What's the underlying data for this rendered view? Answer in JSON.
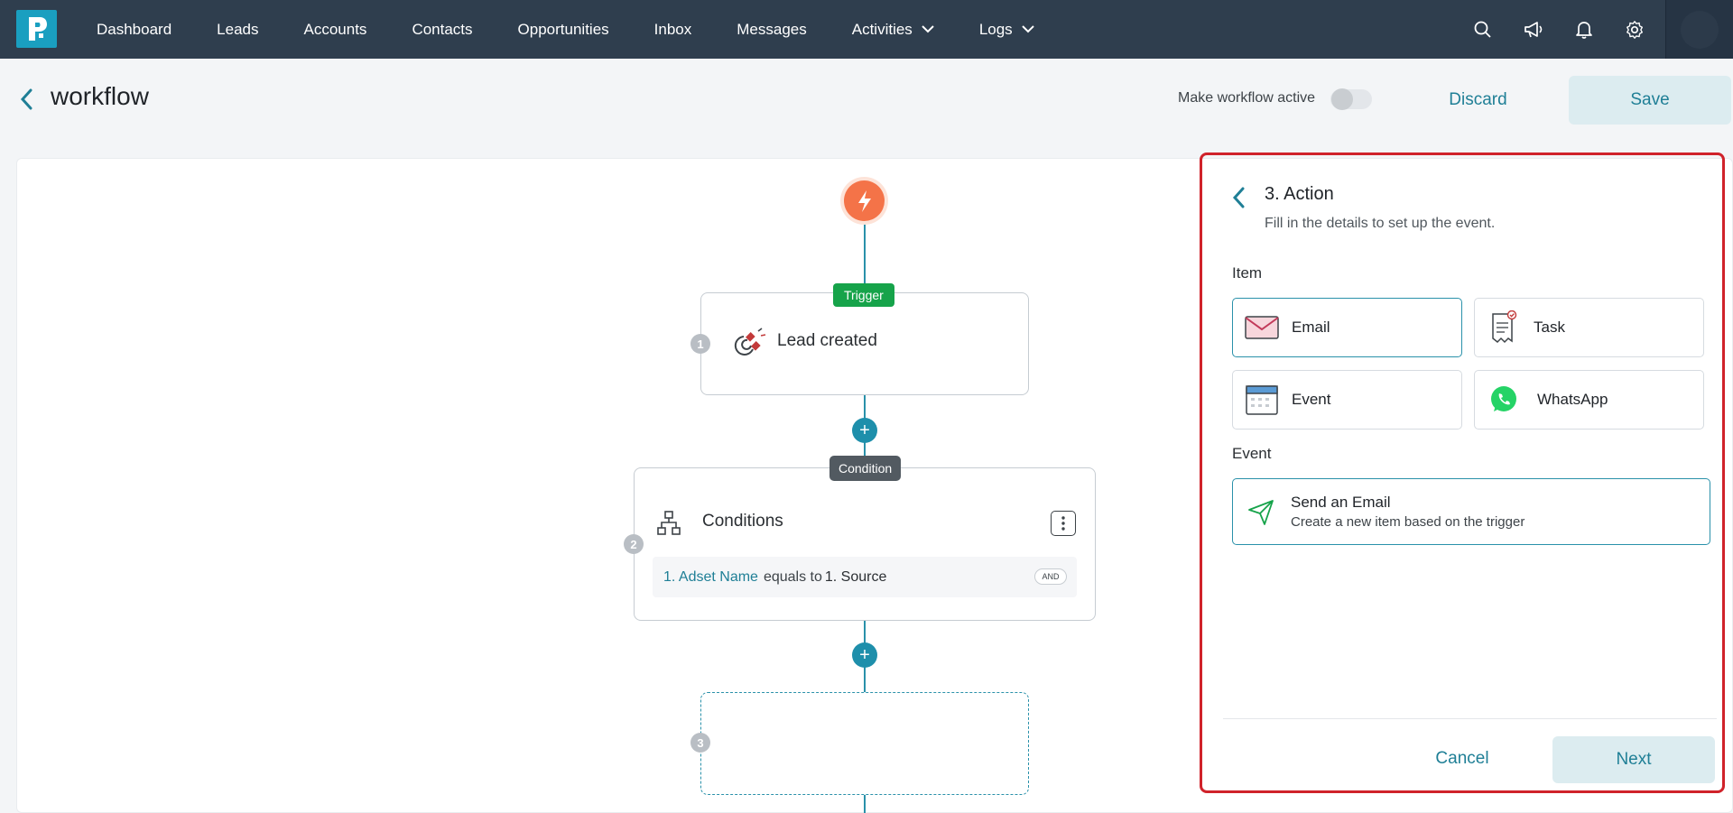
{
  "nav": {
    "items": [
      {
        "label": "Dashboard"
      },
      {
        "label": "Leads"
      },
      {
        "label": "Accounts"
      },
      {
        "label": "Contacts"
      },
      {
        "label": "Opportunities"
      },
      {
        "label": "Inbox"
      },
      {
        "label": "Messages"
      },
      {
        "label": "Activities"
      },
      {
        "label": "Logs"
      }
    ],
    "icons": [
      "search-icon",
      "megaphone-icon",
      "bell-icon",
      "gear-icon"
    ]
  },
  "header": {
    "title": "workflow",
    "active_label": "Make workflow active",
    "active": false,
    "discard_label": "Discard",
    "save_label": "Save"
  },
  "flow": {
    "trigger_tag": "Trigger",
    "step1": {
      "num": "1",
      "title": "Lead created"
    },
    "condition_tag": "Condition",
    "step2": {
      "num": "2",
      "title": "Conditions",
      "rule": {
        "field": "1. Adset Name",
        "operator": "equals to",
        "value": "1. Source",
        "joiner": "AND"
      }
    },
    "step3": {
      "num": "3"
    },
    "plus_symbol": "+"
  },
  "panel": {
    "title": "3. Action",
    "subtitle": "Fill in the details to set up the event.",
    "item_label": "Item",
    "items": [
      {
        "label": "Email",
        "icon": "email-icon",
        "selected": true
      },
      {
        "label": "Task",
        "icon": "task-icon",
        "selected": false
      },
      {
        "label": "Event",
        "icon": "calendar-icon",
        "selected": false
      },
      {
        "label": "WhatsApp",
        "icon": "whatsapp-icon",
        "selected": false
      }
    ],
    "event_label": "Event",
    "event": {
      "title": "Send an Email",
      "desc": "Create a new item based on the trigger"
    },
    "cancel_label": "Cancel",
    "next_label": "Next"
  },
  "colors": {
    "nav_bg": "#2f3e4e",
    "accent": "#1f7f96",
    "trigger_green": "#16a34a",
    "bolt_orange": "#f47348",
    "highlight_red": "#d0222a"
  }
}
